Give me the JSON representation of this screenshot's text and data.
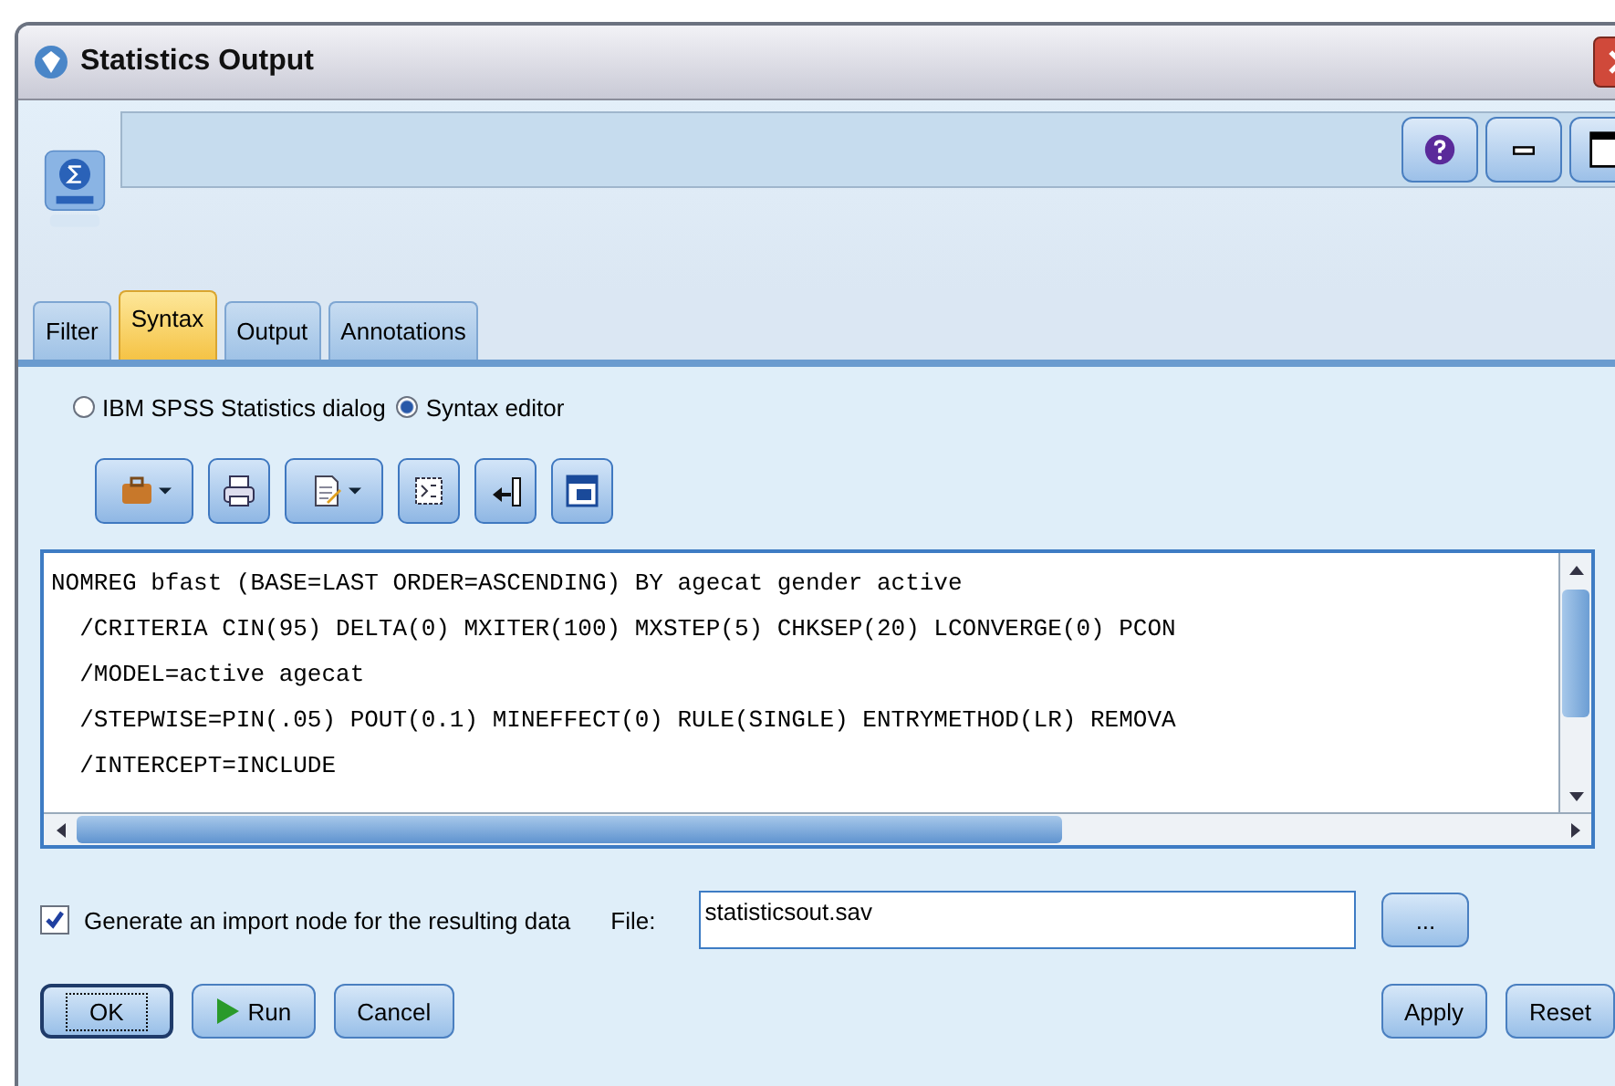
{
  "window": {
    "title": "Statistics Output"
  },
  "tabs": [
    {
      "label": "Filter",
      "selected": false
    },
    {
      "label": "Syntax",
      "selected": true
    },
    {
      "label": "Output",
      "selected": false
    },
    {
      "label": "Annotations",
      "selected": false
    }
  ],
  "mode_options": [
    {
      "label": "IBM SPSS Statistics dialog",
      "selected": false
    },
    {
      "label": "Syntax editor",
      "selected": true
    }
  ],
  "toolbar": [
    {
      "kind": "case",
      "dropdown": true
    },
    {
      "kind": "print",
      "dropdown": false
    },
    {
      "kind": "document",
      "dropdown": true
    },
    {
      "kind": "grid",
      "dropdown": false
    },
    {
      "kind": "insert",
      "dropdown": false
    },
    {
      "kind": "window",
      "dropdown": false
    }
  ],
  "syntax_lines": [
    "NOMREG bfast (BASE=LAST ORDER=ASCENDING) BY agecat gender active",
    "  /CRITERIA CIN(95) DELTA(0) MXITER(100) MXSTEP(5) CHKSEP(20) LCONVERGE(0) PCON",
    "  /MODEL=active agecat",
    "  /STEPWISE=PIN(.05) POUT(0.1) MINEFFECT(0) RULE(SINGLE) ENTRYMETHOD(LR) REMOVA",
    "  /INTERCEPT=INCLUDE"
  ],
  "import_option": {
    "label": "Generate an import node for the resulting data",
    "checked": true
  },
  "file": {
    "label": "File:",
    "value": "statisticsout.sav",
    "browse": "..."
  },
  "left_buttons": [
    {
      "kind": "default",
      "label": "OK"
    },
    {
      "kind": "run",
      "label": "Run"
    },
    {
      "kind": "plain",
      "label": "Cancel"
    }
  ],
  "right_buttons": [
    {
      "label": "Apply"
    },
    {
      "label": "Reset"
    }
  ]
}
